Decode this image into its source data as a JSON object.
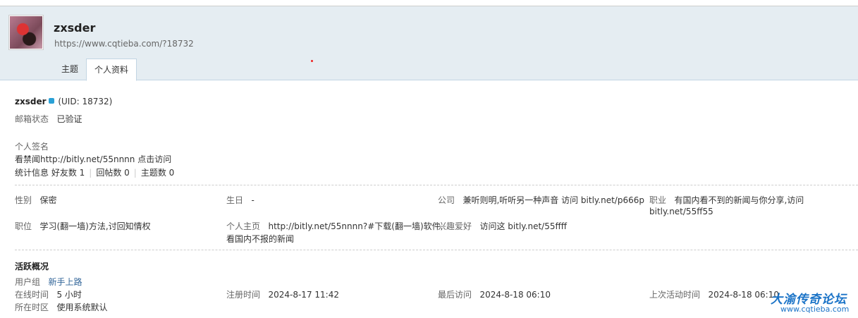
{
  "header": {
    "username": "zxsder",
    "url": "https://www.cqtieba.com/?18732",
    "tabs": [
      {
        "label": "主题",
        "active": false
      },
      {
        "label": "个人资料",
        "active": true
      }
    ]
  },
  "profile": {
    "name": "zxsder",
    "uid": "(UID: 18732)",
    "email_label": "邮箱状态",
    "email_value": "已验证",
    "signature_label": "个人签名",
    "signature_value": "看禁闻http://bitly.net/55nnnn 点击访问",
    "stats_label": "统计信息",
    "stats": [
      "好友数 1",
      "回帖数 0",
      "主题数 0"
    ]
  },
  "fields": {
    "gender_label": "性别",
    "gender_value": "保密",
    "birthday_label": "生日",
    "birthday_value": "-",
    "company_label": "公司",
    "company_value": "兼听则明,听听另一种声音 访问 bitly.net/p666p",
    "occupation_label": "职业",
    "occupation_value_1": "有国内看不到的新闻与你分享,访问",
    "occupation_value_2": "bitly.net/55ff55",
    "position_label": "职位",
    "position_value": "学习(翻一墙)方法,讨回知情权",
    "homepage_label": "个人主页",
    "homepage_value_1": "http://bitly.net/55nnnn?#下载(翻一墙)软件,",
    "homepage_value_2": "看国内不报的新闻",
    "hobby_label": "兴趣爱好",
    "hobby_value": "访问这 bitly.net/55ffff"
  },
  "activity": {
    "title": "活跃概况",
    "group_label": "用户组",
    "group_value": "新手上路",
    "online_label": "在线时间",
    "online_value": "5 小时",
    "timezone_label": "所在时区",
    "timezone_value": "使用系统默认",
    "register_label": "注册时间",
    "register_value": "2024-8-17 11:42",
    "lastvisit_label": "最后访问",
    "lastvisit_value": "2024-8-18 06:10",
    "lastactive_label": "上次活动时间",
    "lastactive_value": "2024-8-18 06:10"
  },
  "watermark": {
    "title": "大渝传奇论坛",
    "site": "www.cqtieba.com"
  },
  "colors": {
    "header_bg": "#e5edf2",
    "link": "#336699",
    "online_badge": "#2aa1d6",
    "watermark": "#1a73c7"
  }
}
